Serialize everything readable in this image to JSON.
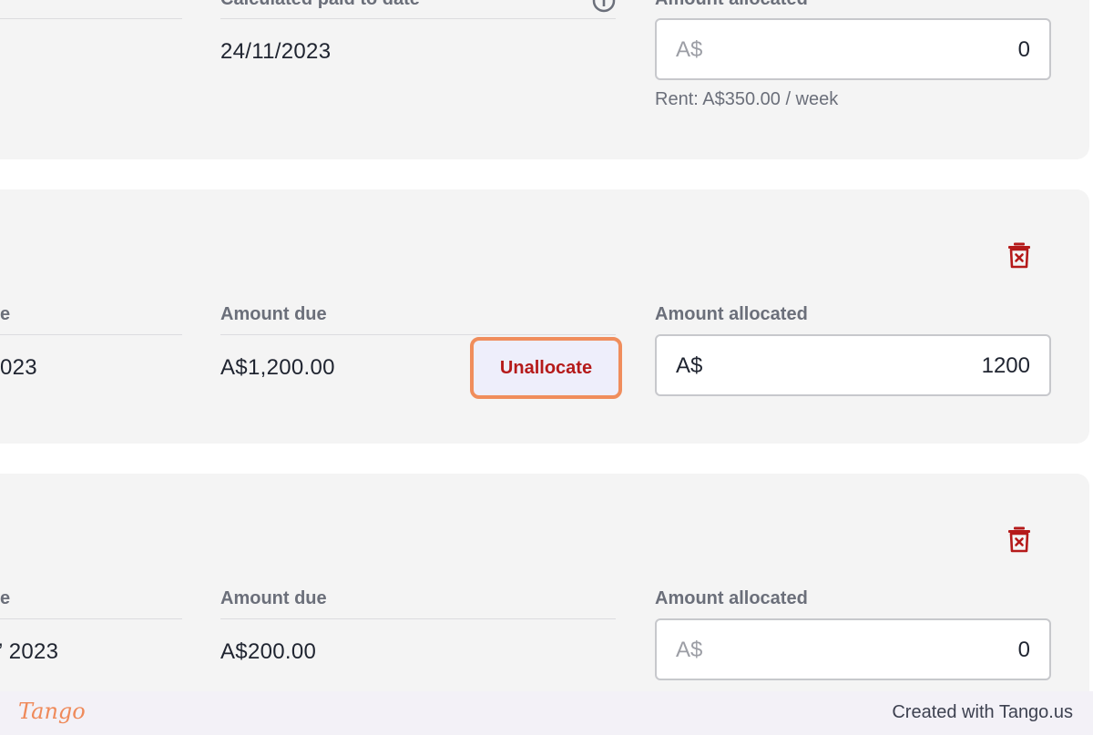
{
  "row1": {
    "paid_label": "Calculated paid to date",
    "paid_value": "24/11/2023",
    "allocated_label": "Amount allocated",
    "currency": "A$",
    "allocated_value": "0",
    "rent_hint": "Rent: A$350.00 / week"
  },
  "row2": {
    "left_label_fragment": "e",
    "left_value_fragment": "023",
    "due_label": "Amount due",
    "due_value": "A$1,200.00",
    "unallocate_label": "Unallocate",
    "allocated_label": "Amount allocated",
    "currency": "A$",
    "allocated_value": "1200"
  },
  "row3": {
    "left_label_fragment": "e",
    "left_value_fragment": "’ 2023",
    "due_label": "Amount due",
    "due_value": "A$200.00",
    "allocated_label": "Amount allocated",
    "currency": "A$",
    "allocated_value": "0"
  },
  "footer": {
    "brand": "Tango",
    "credit": "Created with Tango.us"
  },
  "colors": {
    "danger": "#b51a1a",
    "highlight": "#f08d5c",
    "card_bg": "#f4f4f4"
  }
}
